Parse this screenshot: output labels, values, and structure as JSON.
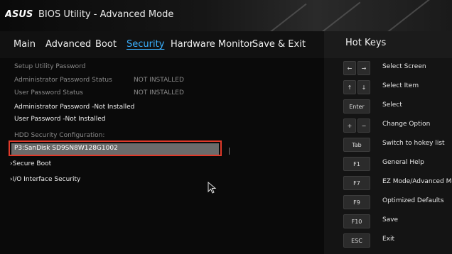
{
  "app": {
    "logo_text": "ASUS",
    "title": "BIOS Utility - Advanced Mode"
  },
  "menu": {
    "items": [
      {
        "label": "Main"
      },
      {
        "label": "Advanced"
      },
      {
        "label": "Boot"
      },
      {
        "label": "Security",
        "active": true
      },
      {
        "label": "Hardware Monitor"
      },
      {
        "label": "Save & Exit"
      }
    ]
  },
  "hotkeys_title": "Hot Keys",
  "security": {
    "setup_utility_password": "Setup Utility Password",
    "admin_status_label": "Administrator Password Status",
    "admin_status_value": "NOT INSTALLED",
    "user_status_label": "User Password Status",
    "user_status_value": "NOT INSTALLED",
    "admin_password": "Administrator Password -Not Installed",
    "user_password": "User Password -Not Installed",
    "hdd_config": "HDD Security Configuration:",
    "hdd_item": "P3:SanDisk SD9SN8W128G1002",
    "secure_boot": "Secure Boot",
    "io_security": "I/O Interface Security"
  },
  "hotkeys": [
    {
      "keys": [
        "←",
        "→"
      ],
      "desc": "Select Screen"
    },
    {
      "keys": [
        "↑",
        "↓"
      ],
      "desc": "Select Item"
    },
    {
      "keys": [
        "Enter"
      ],
      "desc": "Select"
    },
    {
      "keys": [
        "+",
        "−"
      ],
      "desc": "Change Option"
    },
    {
      "keys": [
        "Tab"
      ],
      "desc": "Switch to hokey list"
    },
    {
      "keys": [
        "F1"
      ],
      "desc": "General Help"
    },
    {
      "keys": [
        "F7"
      ],
      "desc": "EZ Mode/Advanced Mod"
    },
    {
      "keys": [
        "F9"
      ],
      "desc": "Optimized Defaults"
    },
    {
      "keys": [
        "F10"
      ],
      "desc": "Save"
    },
    {
      "keys": [
        "ESC"
      ],
      "desc": "Exit"
    }
  ],
  "colors": {
    "accent": "#3ab0ff",
    "highlight_border": "#e03a2a",
    "selected_row": "#6b6b6b"
  }
}
